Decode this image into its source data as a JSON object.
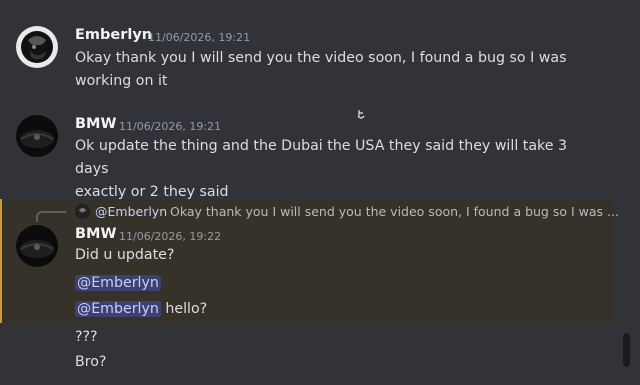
{
  "messages": [
    {
      "username": "Emberlyn",
      "timestamp": "11/06/2026, 19:21",
      "lines": [
        "Okay thank you I will send you the video soon, I found a bug so I was",
        "working on it"
      ]
    },
    {
      "username": "BMW",
      "timestamp": "11/06/2026, 19:21",
      "lines": [
        "Ok update the thing and the Dubai the USA they said they will take 3 days",
        "exactly or 2 they said"
      ]
    },
    {
      "username": "BMW",
      "timestamp": "11/06/2026, 19:22",
      "reply": {
        "mention": "@Emberlyn",
        "text": "Okay thank you I will send you the video soon, I found a bug so I was ..."
      },
      "lines": [
        "Did u update?"
      ],
      "mentions": [
        {
          "mention": "@Emberlyn",
          "suffix": ""
        },
        {
          "mention": "@Emberlyn",
          "suffix": " hello?"
        }
      ]
    },
    {
      "lines": [
        "???"
      ]
    },
    {
      "lines": [
        "Bro?"
      ]
    }
  ],
  "colors": {
    "background": "#323339",
    "highlight": "#36322a",
    "highlight_border": "#c99a2e",
    "mention_bg": "#3c4270",
    "mention_text": "#c9cdfb"
  },
  "icons": {
    "cursor": "cursor-icon",
    "avatar_emberlyn": "avatar-emberlyn",
    "avatar_bmw": "avatar-bmw"
  }
}
